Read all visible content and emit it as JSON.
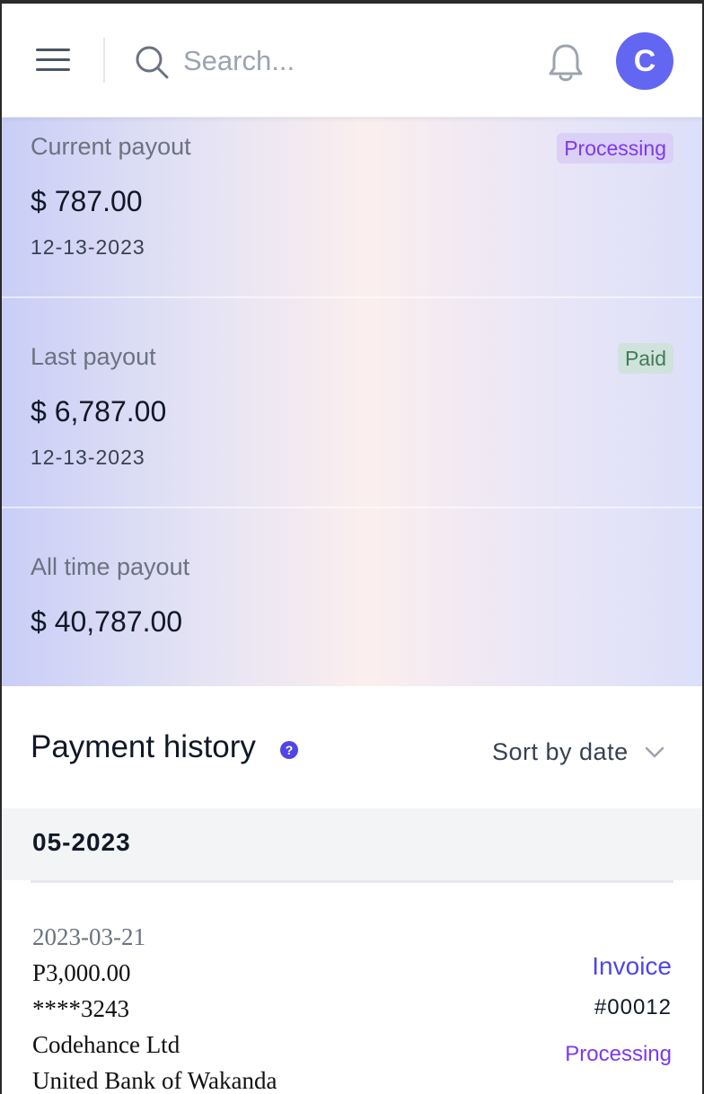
{
  "header": {
    "search_placeholder": "Search...",
    "avatar_initial": "C",
    "accent_color": "#6366f1"
  },
  "stats": [
    {
      "label": "Current payout",
      "value": "$ 787.00",
      "date": "12-13-2023",
      "badge": "Processing"
    },
    {
      "label": "Last payout",
      "value": "$ 6,787.00",
      "date": "12-13-2023",
      "badge": "Paid"
    },
    {
      "label": "All time payout",
      "value": "$ 40,787.00"
    }
  ],
  "history": {
    "title": "Payment history",
    "help_glyph": "?",
    "sort_label": "Sort by date",
    "month": "05-2023",
    "rows": [
      {
        "date": "2023-03-21",
        "amount": "P3,000.00",
        "card": "****3243",
        "company": "Codehance Ltd",
        "bank": "United Bank of Wakanda",
        "invoice_label": "Invoice",
        "invoice_number": "#00012",
        "status": "Processing"
      }
    ]
  },
  "icons": {
    "menu": "menu-icon",
    "search": "search-icon",
    "bell": "bell-icon",
    "help": "help-icon",
    "chevron": "chevron-down-icon"
  }
}
